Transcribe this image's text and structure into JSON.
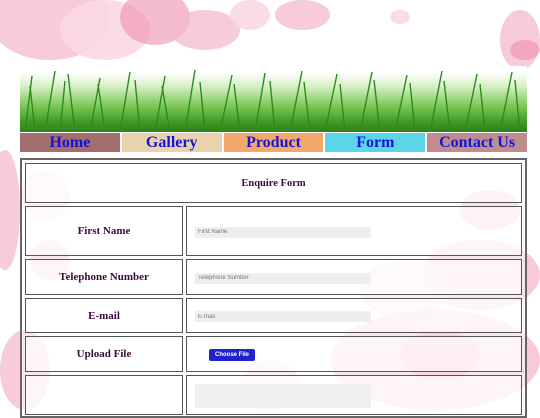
{
  "nav": {
    "items": [
      {
        "label": "Home",
        "bg": "#a56e6e"
      },
      {
        "label": "Gallery",
        "bg": "#e8d3ac"
      },
      {
        "label": "Product",
        "bg": "#f3a86b"
      },
      {
        "label": "Form",
        "bg": "#5bd6e8"
      },
      {
        "label": "Contact Us",
        "bg": "#bf8d8d"
      }
    ]
  },
  "form": {
    "title": "Enquire Form",
    "first_name_label": "First Name",
    "first_name_placeholder": "First Name",
    "telephone_label": "Telephone Number",
    "telephone_placeholder": "Telephone Number",
    "email_label": "E-mail",
    "email_placeholder": "E-mail",
    "upload_label": "Upload File",
    "upload_button": "Choose File"
  },
  "colors": {
    "link": "#1414d8",
    "label": "#3a0b3a",
    "button": "#2222cc"
  }
}
